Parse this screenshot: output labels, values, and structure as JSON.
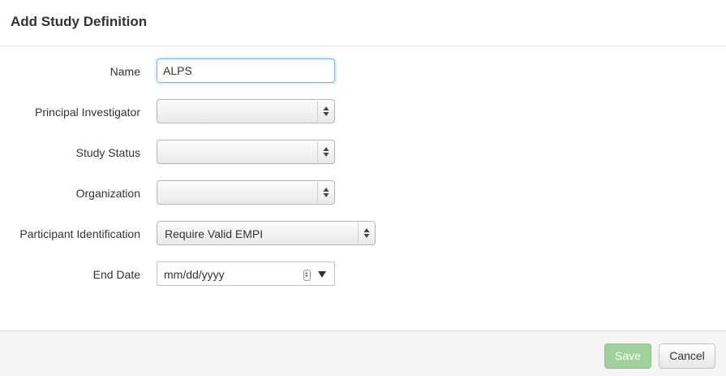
{
  "dialog": {
    "title": "Add Study Definition"
  },
  "form": {
    "name": {
      "label": "Name",
      "value": "ALPS"
    },
    "principal_investigator": {
      "label": "Principal Investigator",
      "value": ""
    },
    "study_status": {
      "label": "Study Status",
      "value": ""
    },
    "organization": {
      "label": "Organization",
      "value": ""
    },
    "participant_identification": {
      "label": "Participant Identification",
      "value": "Require Valid EMPI"
    },
    "end_date": {
      "label": "End Date",
      "placeholder": "mm/dd/yyyy"
    }
  },
  "footer": {
    "save_label": "Save",
    "cancel_label": "Cancel"
  },
  "colors": {
    "save_button": "#9ed29a",
    "input_focus_border": "#7cb7e8"
  },
  "icons": {
    "select_arrows": "updown-arrows-icon",
    "date_spinner": "spinner-icon",
    "date_dropdown": "dropdown-triangle-icon"
  }
}
